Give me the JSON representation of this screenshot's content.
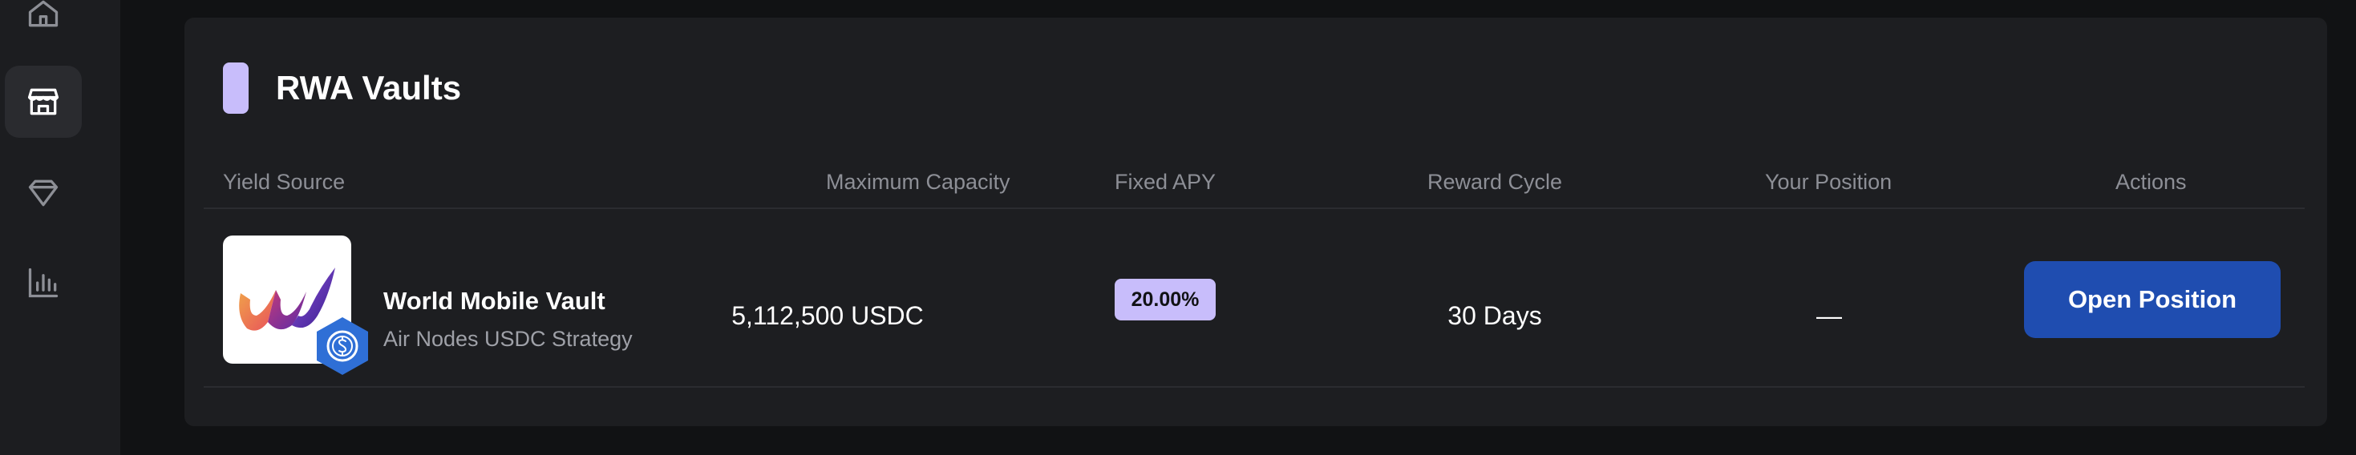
{
  "sidebar": {
    "items": [
      {
        "icon": "home-icon",
        "active": false
      },
      {
        "icon": "store-icon",
        "active": true
      },
      {
        "icon": "diamond-icon",
        "active": false
      },
      {
        "icon": "bar-chart-icon",
        "active": false
      }
    ]
  },
  "section": {
    "title": "RWA Vaults",
    "accent_color": "#c8bdfb"
  },
  "table": {
    "columns": [
      "Yield Source",
      "Maximum Capacity",
      "Fixed APY",
      "Reward Cycle",
      "Your Position",
      "Actions"
    ],
    "rows": [
      {
        "name": "World Mobile Vault",
        "subtitle": "Air Nodes USDC Strategy",
        "max_capacity": "5,112,500 USDC",
        "fixed_apy": "20.00%",
        "reward_cycle": "30 Days",
        "your_position": "—",
        "action_label": "Open Position",
        "logo_icon": "world-mobile-logo",
        "badge_icon": "usdc-icon"
      }
    ]
  },
  "colors": {
    "background": "#111214",
    "card": "#1d1e21",
    "button": "#1f4db0",
    "apy_badge": "#c8bdfb"
  }
}
